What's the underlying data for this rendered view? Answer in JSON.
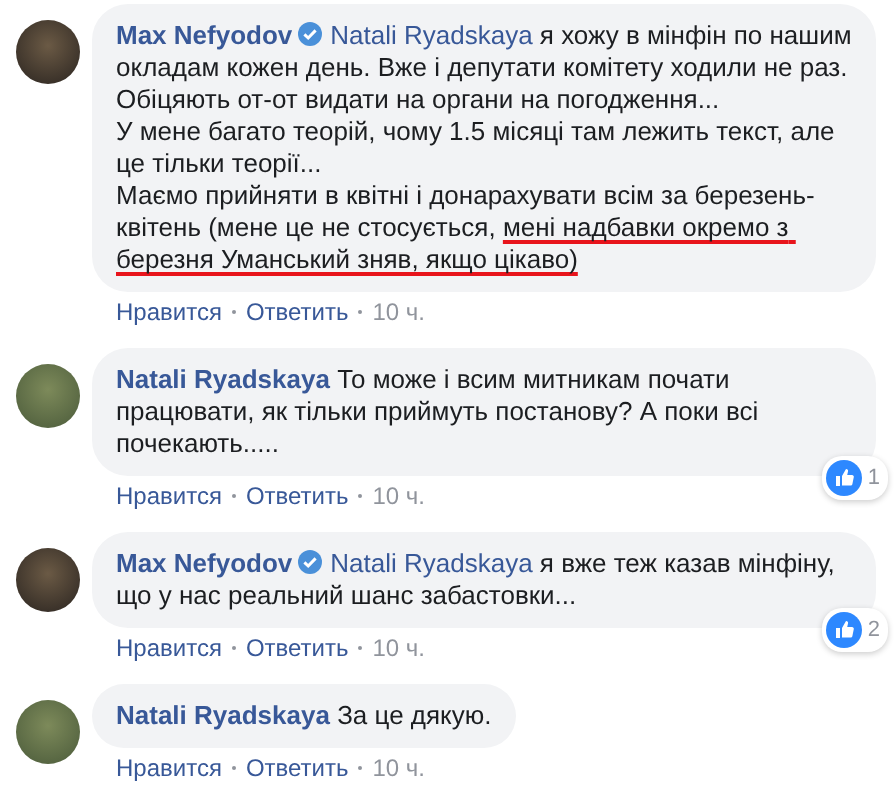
{
  "comments": [
    {
      "author": "Max Nefyodov",
      "verified": true,
      "mention": "Natali Ryadskaya",
      "segments": [
        {
          "text": "я хожу в мінфін по нашим окладам кожен день. Вже і депутати комітету ходили не раз. Обіцяють от-от видати на органи на погодження...\nУ мене багато теорій, чому 1.5 місяці там лежить текст, але це тільки теорії...\nМаємо прийняти в квітні і донарахувати всім за березень-квітень (мене це не стосується, ",
          "underlined": false
        },
        {
          "text": "мені надбавки окремо з березня Уманський зняв, якщо цікаво)",
          "underlined": true
        }
      ],
      "actions": [
        "Нравится",
        "Ответить"
      ],
      "time": "10 ч."
    },
    {
      "author": "Natali Ryadskaya",
      "verified": false,
      "segments": [
        {
          "text": "То може і всим митникам почати працювати, як тільки приймуть постанову? А поки всі почекають.....",
          "underlined": false
        }
      ],
      "reactions": "1",
      "actions": [
        "Нравится",
        "Ответить"
      ],
      "time": "10 ч."
    },
    {
      "author": "Max Nefyodov",
      "verified": true,
      "mention": "Natali Ryadskaya",
      "segments": [
        {
          "text": "я вже теж казав мінфіну, що у нас реальний шанс забастовки...",
          "underlined": false
        }
      ],
      "reactions": "2",
      "actions": [
        "Нравится",
        "Ответить"
      ],
      "time": "10 ч."
    },
    {
      "author": "Natali Ryadskaya",
      "verified": false,
      "segments": [
        {
          "text": "За це дякую.",
          "underlined": false
        }
      ],
      "actions": [
        "Нравится",
        "Ответить"
      ],
      "time": "10 ч."
    }
  ]
}
